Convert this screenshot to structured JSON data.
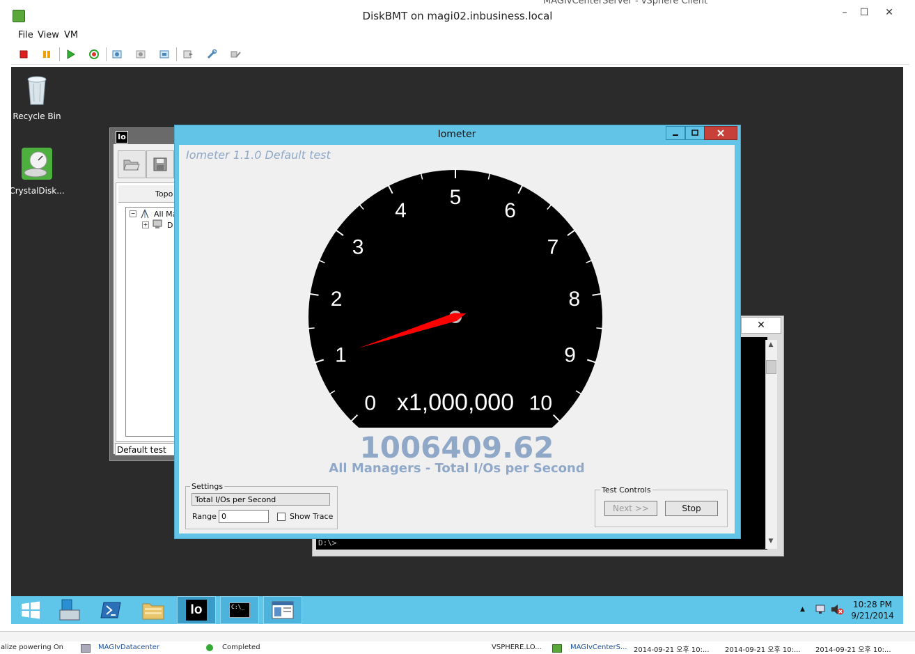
{
  "outer_window": {
    "title": "DiskBMT on magi02.inbusiness.local",
    "background_title": "MAGIvCenterServer - vSphere Client",
    "minimize": "–",
    "maximize": "☐",
    "close": "✕"
  },
  "menu": [
    "File",
    "View",
    "VM"
  ],
  "desktop_icons": [
    {
      "label": "Recycle Bin",
      "icon": "recycle-bin-icon"
    },
    {
      "label": "CrystalDisk...",
      "icon": "crystaldisk-icon"
    }
  ],
  "bg_iometer": {
    "title_badge": "Io",
    "tab_label": "Topo",
    "tree_root": "All Ma",
    "tree_child": "D",
    "status": "Default test"
  },
  "iometer": {
    "title": "Iometer",
    "test_name": "Iometer 1.1.0 Default test",
    "reading": "1006409.62",
    "reading_label": "All Managers - Total I/Os per Second",
    "gauge": {
      "tick_labels": [
        "0",
        "1",
        "2",
        "3",
        "4",
        "5",
        "6",
        "7",
        "8",
        "9",
        "10"
      ],
      "multiplier": "x1,000,000",
      "min": 0,
      "max": 10,
      "value": 1.0064
    },
    "settings": {
      "legend": "Settings",
      "metric": "Total I/Os per Second",
      "range_label": "Range",
      "range_value": "0",
      "show_trace_label": "Show Trace",
      "show_trace": false
    },
    "test_controls": {
      "legend": "Test Controls",
      "next_label": "Next >>",
      "stop_label": "Stop"
    }
  },
  "cmd_window": {
    "prompt": "D:\\>",
    "close": "✕"
  },
  "taskbar": {
    "iometer_badge": "Io",
    "cmd_badge": "C:\\_",
    "time": "10:28 PM",
    "date": "9/21/2014"
  },
  "status_strip": {
    "item1": "alize powering On",
    "item2": "MAGIvDatacenter",
    "item3": "Completed",
    "item4": "VSPHERE.LO...",
    "item5": "MAGIvCenterS...",
    "item6": "2014-09-21 오후 10:...",
    "item7": "2014-09-21 오후 10:...",
    "item8": "2014-09-21 오후 10:..."
  },
  "colors": {
    "taskbar": "#5fc6e9",
    "window_frame": "#62c4e6",
    "reading": "#90a8c8",
    "needle": "#ff0000"
  }
}
